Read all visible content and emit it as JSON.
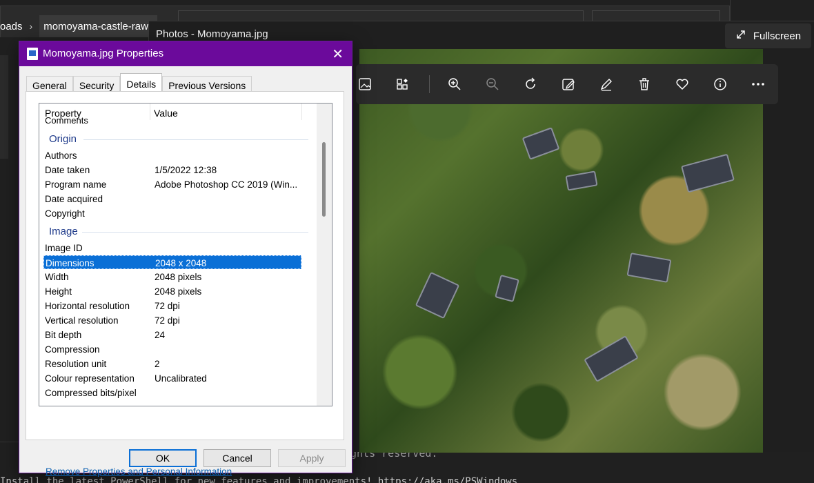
{
  "explorer": {
    "breadcrumb_prev": "oads",
    "breadcrumb_sep": "›",
    "breadcrumb_current": "momoyama-castle-raws"
  },
  "terminal": {
    "line_rights": "ghts reserved.",
    "line_bottom": "Install the latest PowerShell for new features and improvements! https://aka.ms/PSWindows"
  },
  "photos": {
    "title": "Photos - Momoyama.jpg",
    "fullscreen_label": "Fullscreen",
    "toolbar_icons": [
      "image-icon",
      "collection-icon",
      "zoom-in-icon",
      "zoom-out-icon",
      "rotate-icon",
      "edit-image-icon",
      "draw-icon",
      "delete-icon",
      "favorite-icon",
      "info-icon",
      "more-icon"
    ]
  },
  "dialog": {
    "title": "Momoyama.jpg Properties",
    "close_glyph": "✕",
    "tabs": [
      "General",
      "Security",
      "Details",
      "Previous Versions"
    ],
    "active_tab": "Details",
    "columns": {
      "property": "Property",
      "value": "Value"
    },
    "partial_row": "Comments",
    "groups": {
      "origin": {
        "label": "Origin",
        "rows": [
          {
            "k": "Authors",
            "v": ""
          },
          {
            "k": "Date taken",
            "v": "1/5/2022 12:38"
          },
          {
            "k": "Program name",
            "v": "Adobe Photoshop CC 2019 (Win..."
          },
          {
            "k": "Date acquired",
            "v": ""
          },
          {
            "k": "Copyright",
            "v": ""
          }
        ]
      },
      "image": {
        "label": "Image",
        "rows": [
          {
            "k": "Image ID",
            "v": ""
          },
          {
            "k": "Dimensions",
            "v": "2048 x 2048"
          },
          {
            "k": "Width",
            "v": "2048 pixels"
          },
          {
            "k": "Height",
            "v": "2048 pixels"
          },
          {
            "k": "Horizontal resolution",
            "v": "72 dpi"
          },
          {
            "k": "Vertical resolution",
            "v": "72 dpi"
          },
          {
            "k": "Bit depth",
            "v": "24"
          },
          {
            "k": "Compression",
            "v": ""
          },
          {
            "k": "Resolution unit",
            "v": "2"
          },
          {
            "k": "Colour representation",
            "v": "Uncalibrated"
          },
          {
            "k": "Compressed bits/pixel",
            "v": ""
          }
        ]
      }
    },
    "selected_row": "Dimensions",
    "remove_link": "Remove Properties and Personal Information",
    "buttons": {
      "ok": "OK",
      "cancel": "Cancel",
      "apply": "Apply"
    }
  },
  "colors": {
    "dialog_title_bg": "#6b0a9b",
    "selection": "#0a6fd6",
    "link": "#0b5fb0"
  }
}
